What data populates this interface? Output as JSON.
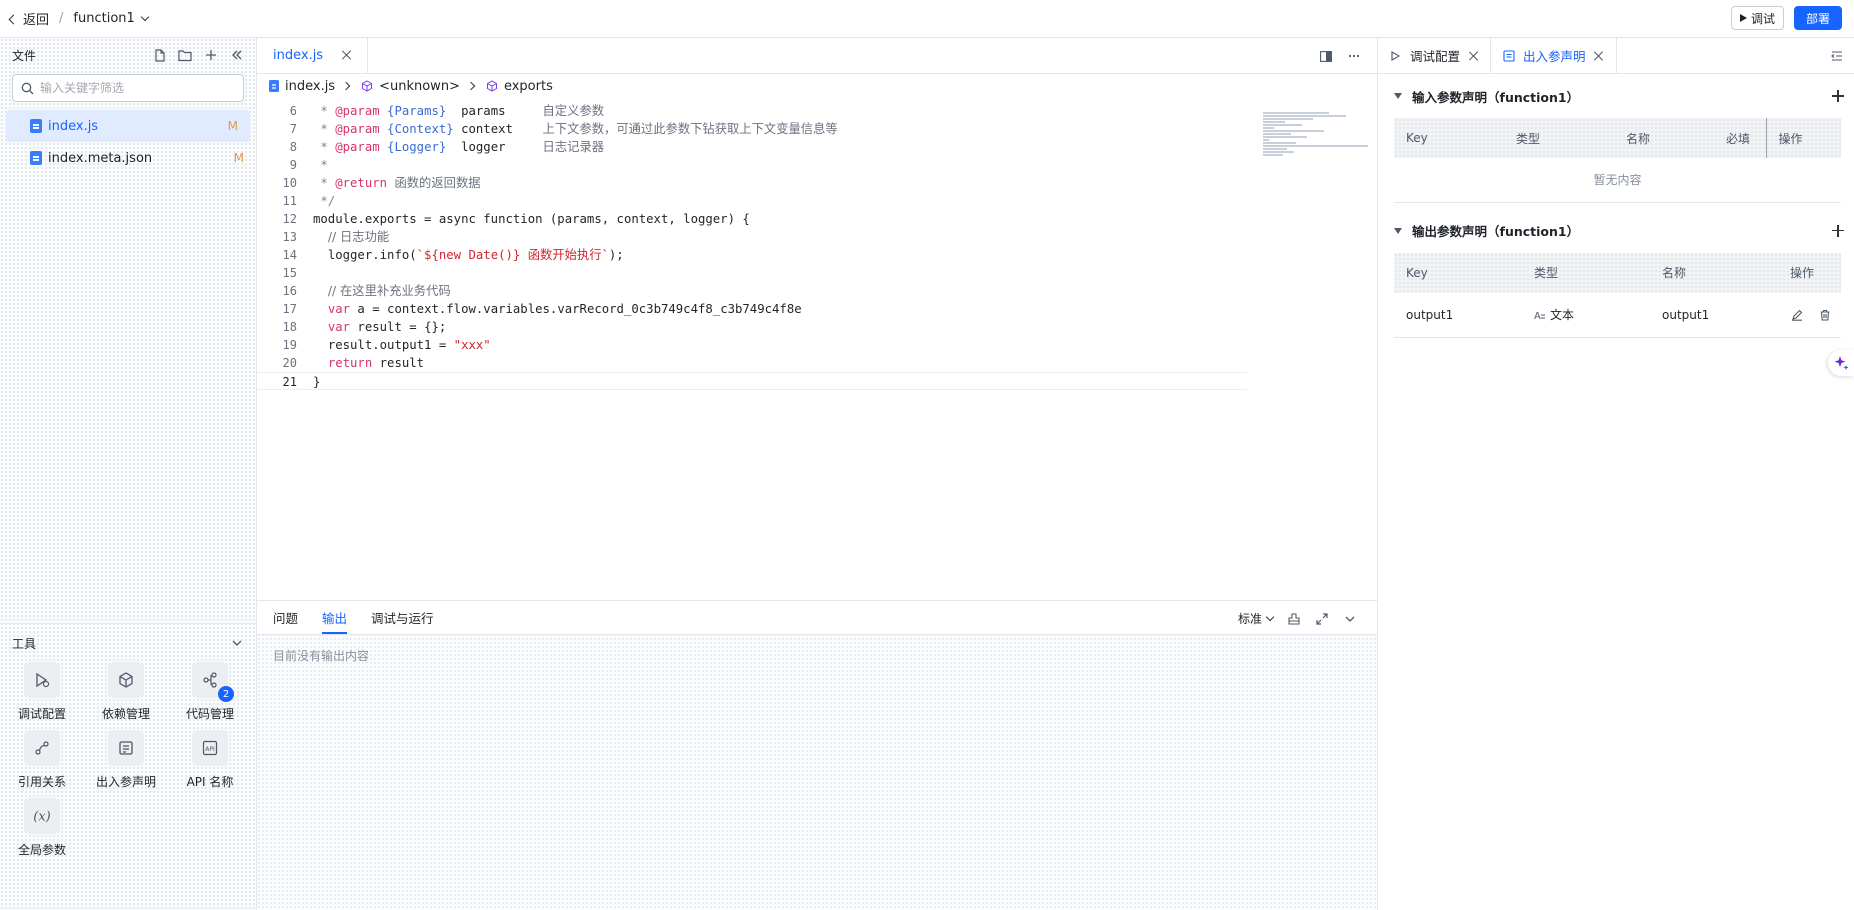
{
  "topbar": {
    "back_label": "返回",
    "breadcrumb_sep": "/",
    "function_name": "function1",
    "debug_label": "调试",
    "deploy_label": "部署"
  },
  "sidebar": {
    "title": "文件",
    "search_placeholder": "输入关键字筛选",
    "files": [
      {
        "name": "index.js",
        "status": "M",
        "active": true
      },
      {
        "name": "index.meta.json",
        "status": "M",
        "active": false
      }
    ],
    "tools_title": "工具",
    "tools": [
      {
        "label": "调试配置",
        "icon": "debug-config-icon"
      },
      {
        "label": "依赖管理",
        "icon": "package-icon"
      },
      {
        "label": "代码管理",
        "icon": "git-branch-icon",
        "badge": "2"
      },
      {
        "label": "引用关系",
        "icon": "reference-icon"
      },
      {
        "label": "出入参声明",
        "icon": "params-icon"
      },
      {
        "label": "API 名称",
        "icon": "api-icon"
      },
      {
        "label": "全局参数",
        "icon": "variable-icon"
      }
    ]
  },
  "editor": {
    "tab_label": "index.js",
    "breadcrumb": [
      "index.js",
      "<unknown>",
      "exports"
    ],
    "line_numbers": [
      "6",
      "7",
      "8",
      "9",
      "10",
      "11",
      "12",
      "13",
      "14",
      "15",
      "16",
      "17",
      "18",
      "19",
      "20",
      "21"
    ],
    "code": {
      "l6_tag": "@param",
      "l6_type": "{Params}",
      "l6_name": "params",
      "l6_desc": "自定义参数",
      "l7_tag": "@param",
      "l7_type": "{Context}",
      "l7_name": "context",
      "l7_desc": "上下文参数，可通过此参数下钻获取上下文变量信息等",
      "l8_tag": "@param",
      "l8_type": "{Logger}",
      "l8_name": "logger",
      "l8_desc": "日志记录器",
      "l10_tag": "@return",
      "l10_desc": "函数的返回数据",
      "l12": "module.exports = async function (params, context, logger) {",
      "l13": "// 日志功能",
      "l14_a": "logger.info(",
      "l14_b": "`${new Date()} 函数开始执行`",
      "l14_c": ");",
      "l16": "// 在这里补充业务代码",
      "l17_kw": "var",
      "l17_rest": " a = context.flow.variables.varRecord_0c3b749c4f8_c3b749c4f8e",
      "l18_kw": "var",
      "l18_rest": " result = {};",
      "l19_a": "result.output1 = ",
      "l19_b": "\"xxx\"",
      "l20_kw": "return",
      "l20_rest": " result",
      "l21": "}"
    }
  },
  "bottom_panel": {
    "tabs": [
      "问题",
      "输出",
      "调试与运行"
    ],
    "active_tab": "输出",
    "level_label": "标准",
    "empty_text": "目前没有输出内容"
  },
  "right_panel": {
    "tabs": [
      {
        "label": "调试配置",
        "active": false
      },
      {
        "label": "出入参声明",
        "active": true
      }
    ],
    "input_section": {
      "title": "输入参数声明（function1）",
      "columns": [
        "Key",
        "类型",
        "名称",
        "必填",
        "操作"
      ],
      "empty_text": "暂无内容"
    },
    "output_section": {
      "title": "输出参数声明（function1）",
      "columns": [
        "Key",
        "类型",
        "名称",
        "操作"
      ],
      "rows": [
        {
          "key": "output1",
          "type": "文本",
          "name": "output1"
        }
      ]
    }
  },
  "colors": {
    "accent": "#1664ff",
    "modified_marker": "#e79b3b",
    "keyword": "#d6336c",
    "type": "#3b6bcf",
    "string": "#d1242f"
  }
}
